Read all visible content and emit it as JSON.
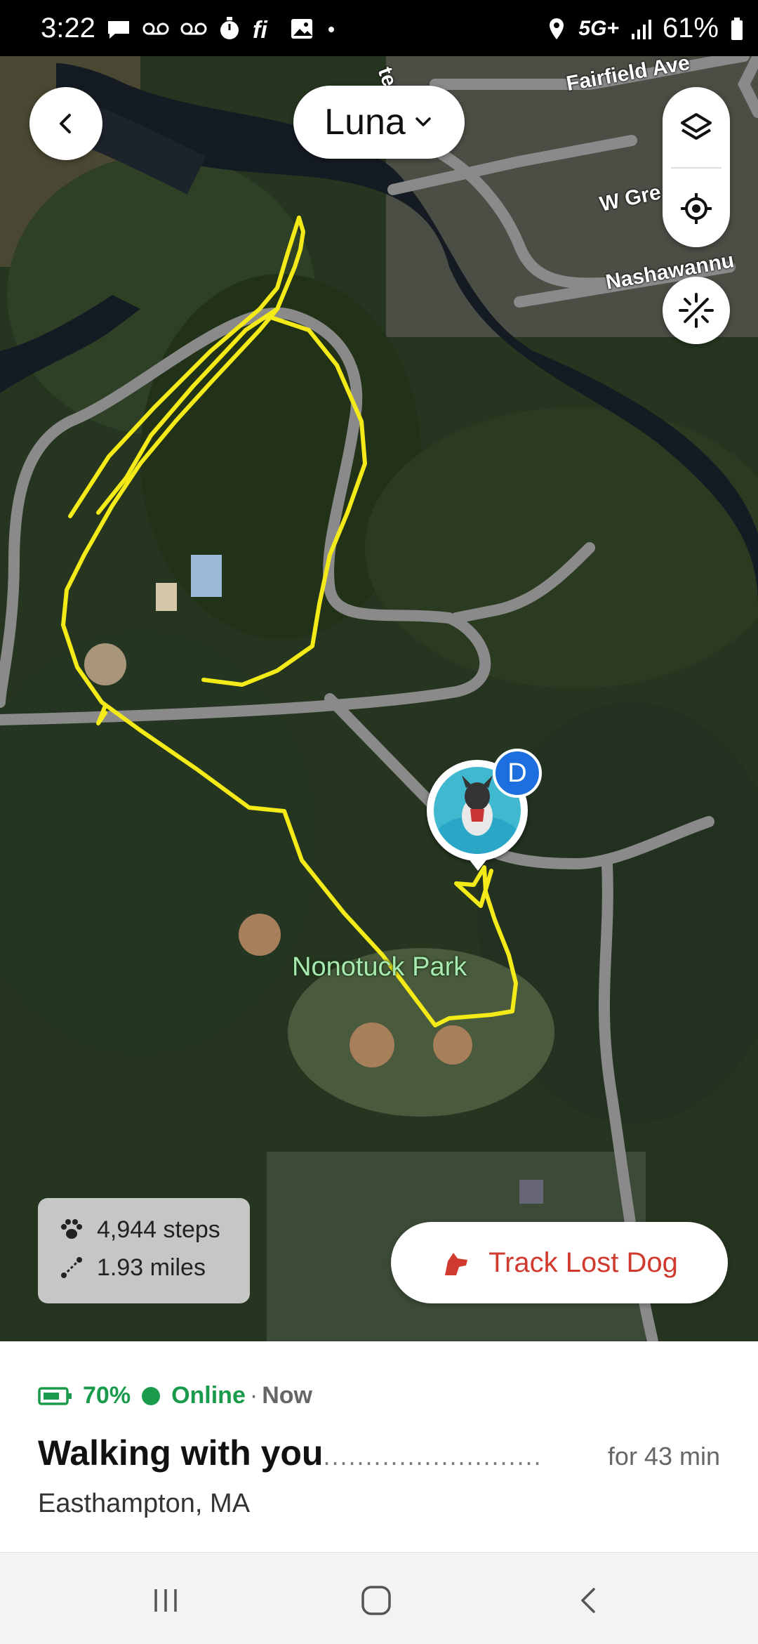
{
  "status_bar": {
    "time": "3:22",
    "network": "5G+",
    "battery": "61%",
    "icons": [
      "chat-bubble-icon",
      "voicemail-icon",
      "voicemail-icon",
      "timer-icon",
      "fi-icon",
      "image-icon",
      "dot-icon"
    ],
    "right_icons": [
      "location-icon",
      "network-5g-icon",
      "signal-icon",
      "battery-icon"
    ]
  },
  "header": {
    "back_icon": "chevron-left-icon",
    "pet_name": "Luna",
    "dropdown_icon": "chevron-down-icon"
  },
  "map_controls": {
    "layers_icon": "layers-icon",
    "locate_icon": "crosshair-icon",
    "compass_icon": "compass-icon"
  },
  "map": {
    "street_labels": [
      "Fairfield Ave",
      "W Gre",
      "Nashawannu",
      "ter"
    ],
    "park_label": "Nonotuck Park",
    "pin_badge": "D",
    "track_color": "#f3ea17"
  },
  "stats": {
    "steps": "4,944 steps",
    "distance": "1.93 miles",
    "steps_icon": "paw-icon",
    "distance_icon": "route-icon"
  },
  "track_button": {
    "label": "Track Lost Dog",
    "icon": "dog-head-icon",
    "color": "#d13b2f"
  },
  "status_sheet": {
    "battery": "70%",
    "online": "Online",
    "separator": "·",
    "time": "Now",
    "activity": "Walking with you",
    "dots": "..........................",
    "duration": "for 43 min",
    "location": "Easthampton, MA",
    "accent": "#1a9b4b"
  },
  "nav_bar": {
    "recents_icon": "recents-icon",
    "home_icon": "home-icon",
    "back_icon": "back-icon"
  }
}
